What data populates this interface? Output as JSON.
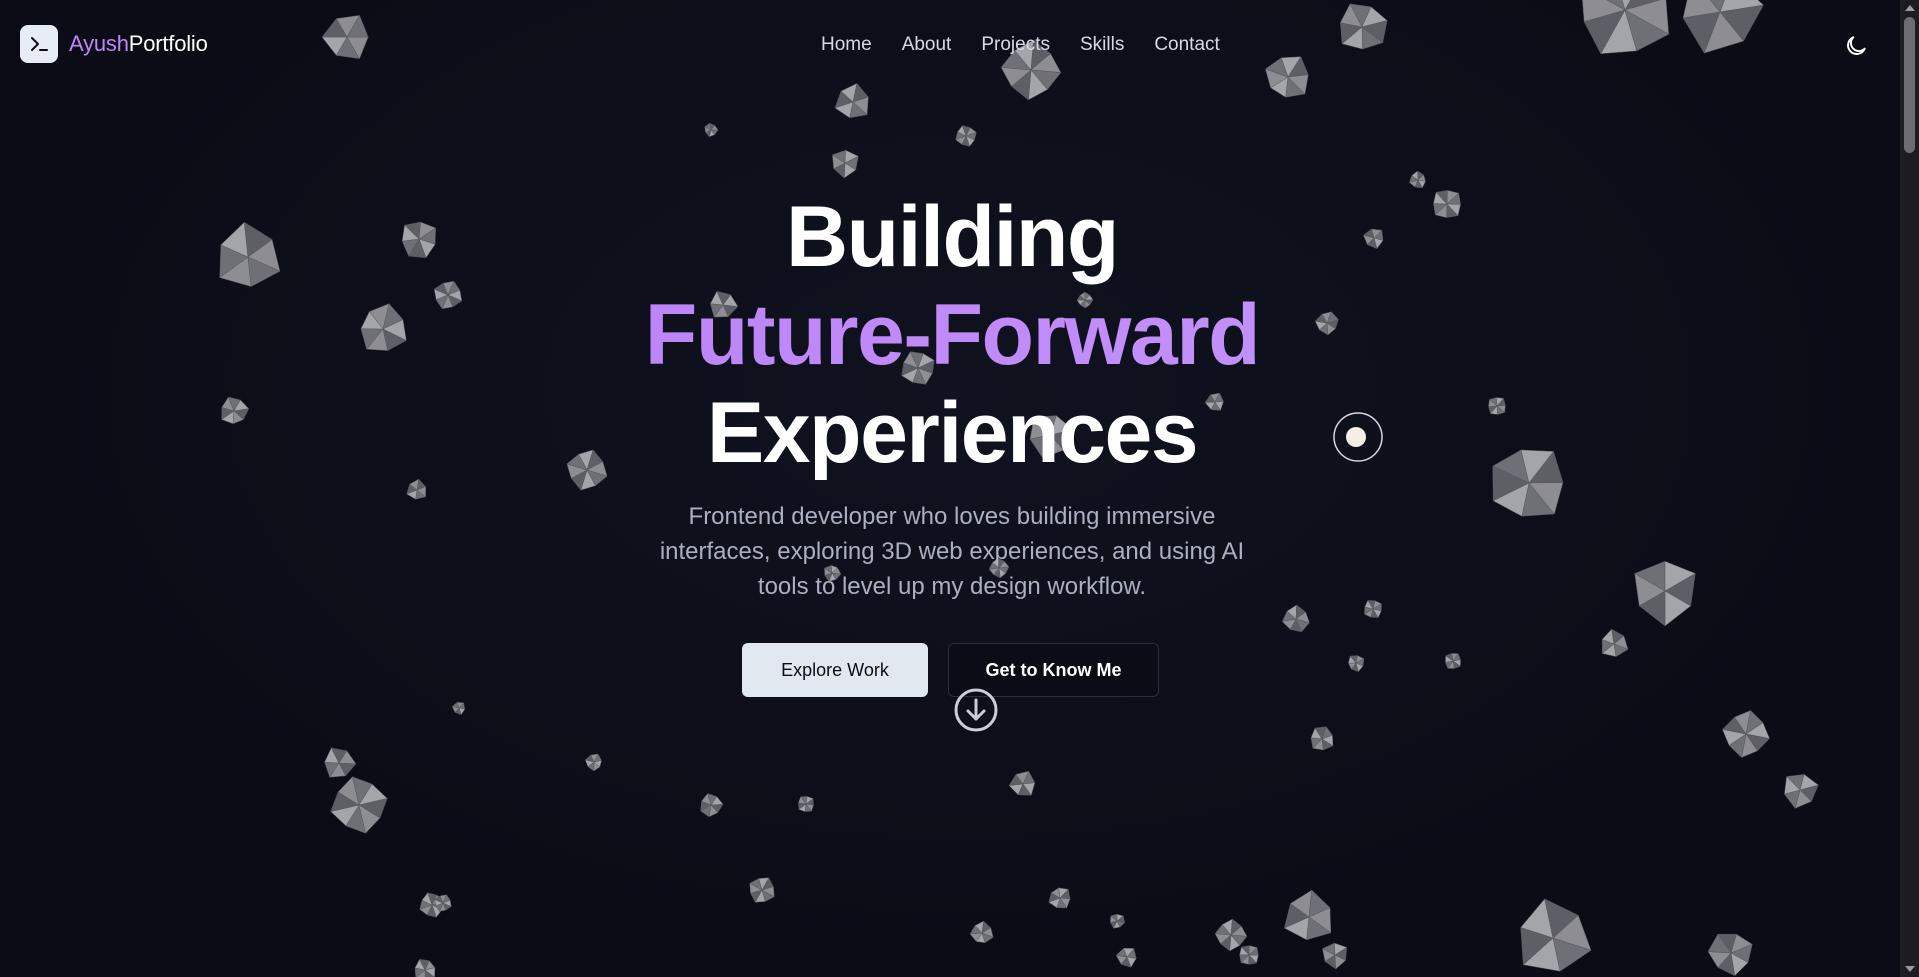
{
  "header": {
    "logo_part1": "Ayush",
    "logo_part2": "Portfolio",
    "logo_icon": "terminal-icon",
    "nav": [
      {
        "label": "Home"
      },
      {
        "label": "About"
      },
      {
        "label": "Projects"
      },
      {
        "label": "Skills"
      },
      {
        "label": "Contact"
      }
    ],
    "theme_icon": "moon-icon"
  },
  "hero": {
    "title_line1": "Building",
    "title_line2": "Future-Forward",
    "title_line3": "Experiences",
    "subtitle": "Frontend developer who loves building immersive interfaces, exploring 3D web experiences, and using AI tools to level up my design workflow.",
    "primary_button": "Explore Work",
    "secondary_button": "Get to Know Me",
    "scroll_icon": "arrow-down-circle-icon"
  },
  "colors": {
    "background": "#0b0c16",
    "accent": "#c084fc",
    "text": "#ffffff",
    "muted": "#a9b0c1",
    "button_light": "#e2e8f0"
  }
}
